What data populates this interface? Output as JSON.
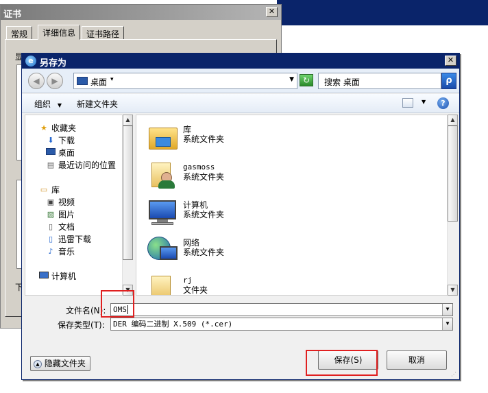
{
  "cert_dialog": {
    "title": "证书",
    "tabs": [
      "常规",
      "详细信息",
      "证书路径"
    ],
    "left_chars": [
      "显",
      "下"
    ]
  },
  "save_dialog": {
    "title": "另存为",
    "address": "桌面",
    "search_placeholder": "搜索 桌面",
    "toolbar": {
      "organize": "组织",
      "new_folder": "新建文件夹"
    },
    "nav": {
      "favorites": "收藏夹",
      "favorites_items": [
        "下载",
        "桌面",
        "最近访问的位置"
      ],
      "libraries": "库",
      "library_items": [
        "视频",
        "图片",
        "文档",
        "迅雷下载",
        "音乐"
      ],
      "computer": "计算机"
    },
    "files": [
      {
        "name": "库",
        "type": "系统文件夹",
        "icon": "library-icon"
      },
      {
        "name": "gasmoss",
        "type": "系统文件夹",
        "icon": "user-folder-icon"
      },
      {
        "name": "计算机",
        "type": "系统文件夹",
        "icon": "computer-icon"
      },
      {
        "name": "网络",
        "type": "系统文件夹",
        "icon": "network-icon"
      },
      {
        "name": "rj",
        "type": "文件夹",
        "icon": "folder-icon"
      }
    ],
    "filename_label": "文件名(N):",
    "filename_value": "OMS",
    "filetype_label": "保存类型(T):",
    "filetype_value": "DER 编码二进制 X.509 (*.cer)",
    "hide_folders": "隐藏文件夹",
    "save_button": "保存(S)",
    "cancel_button": "取消"
  },
  "colors": {
    "titlebar": "#0a246a",
    "highlight": "#e02020"
  }
}
